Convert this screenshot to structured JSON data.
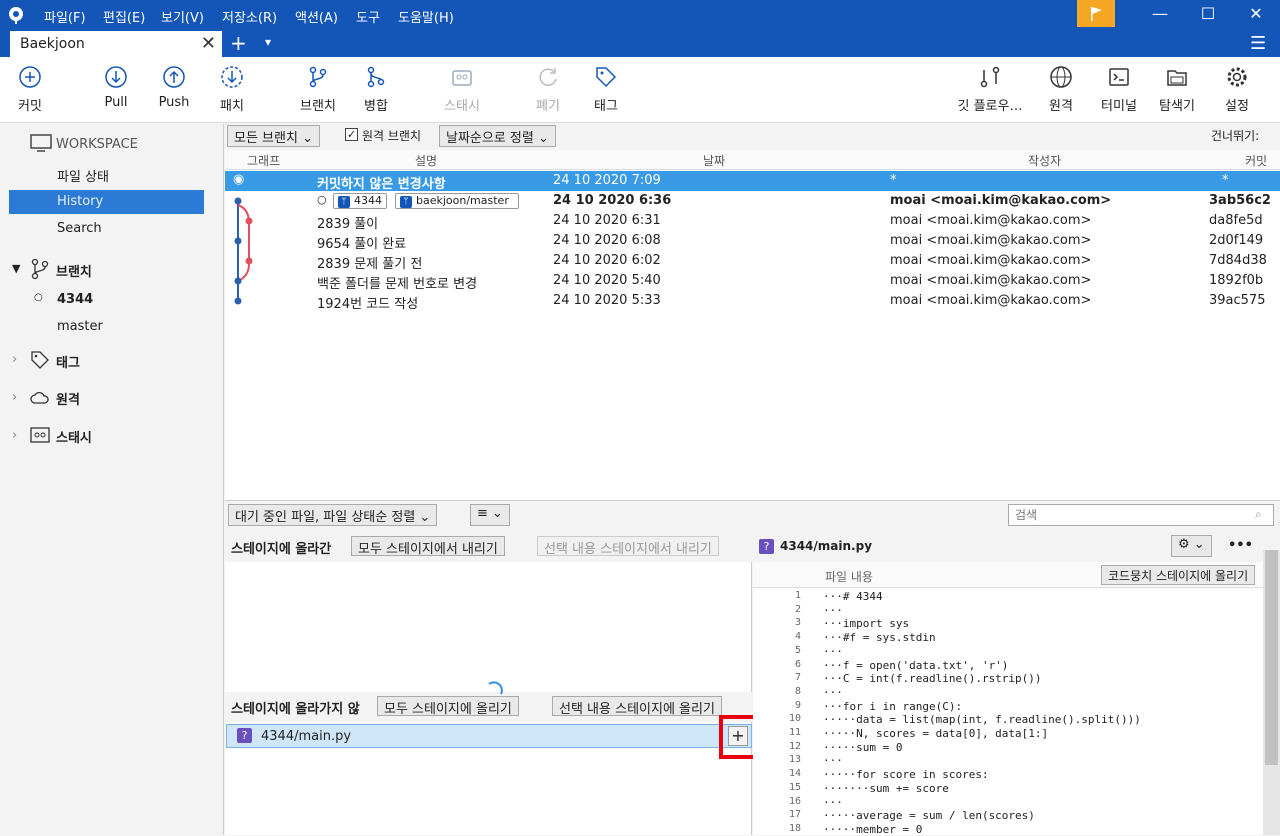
{
  "menubar": {
    "items": [
      "파일(F)",
      "편집(E)",
      "보기(V)",
      "저장소(R)",
      "액션(A)",
      "도구",
      "도움말(H)"
    ]
  },
  "tab": {
    "name": "Baekjoon",
    "close": "✕",
    "new": "+",
    "dropdown": "▾"
  },
  "toolbar": {
    "commit": "커밋",
    "pull": "Pull",
    "push": "Push",
    "patch": "패치",
    "branch": "브랜치",
    "merge": "병합",
    "stash": "스태시",
    "discard": "폐기",
    "tag": "태그",
    "gitflow": "깃 플로우…",
    "remote": "원격",
    "terminal": "터미널",
    "explorer": "탐색기",
    "settings": "설정"
  },
  "sidebar": {
    "workspace": "WORKSPACE",
    "file_status": "파일 상태",
    "history": "History",
    "search": "Search",
    "branches": "브랜치",
    "branch1": "4344",
    "branch2": "master",
    "tags": "태그",
    "remotes": "원격",
    "stashes": "스태시"
  },
  "history": {
    "all_branches": "모든 브랜치 ⌄",
    "remote_branch": "원격 브랜치",
    "sort": "날짜순으로 정렬 ⌄",
    "skip": "건너뛰기:",
    "columns": {
      "graph": "그래프",
      "desc": "설명",
      "date": "날짜",
      "author": "작성자",
      "commit": "커밋"
    },
    "rows": [
      {
        "desc": "커밋하지 않은 변경사항",
        "date": "24 10 2020 7:09",
        "author": "*",
        "commit": "*"
      },
      {
        "desc": "",
        "tag1": "4344",
        "tag2": "baekjoon/master",
        "date": "24 10 2020 6:36",
        "author": "moai <moai.kim@kakao.com>",
        "commit": "3ab56c2"
      },
      {
        "desc": "2839 풀이",
        "date": "24 10 2020 6:31",
        "author": "moai <moai.kim@kakao.com>",
        "commit": "da8fe5d"
      },
      {
        "desc": "9654 풀이 완료",
        "date": "24 10 2020 6:08",
        "author": "moai <moai.kim@kakao.com>",
        "commit": "2d0f149"
      },
      {
        "desc": "2839 문제 풀기 전",
        "date": "24 10 2020 6:02",
        "author": "moai <moai.kim@kakao.com>",
        "commit": "7d84d38"
      },
      {
        "desc": "백준 폴더를 문제 번호로 변경",
        "date": "24 10 2020 5:40",
        "author": "moai <moai.kim@kakao.com>",
        "commit": "1892f0b"
      },
      {
        "desc": "1924번 코드 작성",
        "date": "24 10 2020 5:33",
        "author": "moai <moai.kim@kakao.com>",
        "commit": "39ac575"
      }
    ]
  },
  "filter": {
    "pending": "대기 중인 파일, 파일 상태순 정렬 ⌄",
    "view": "≡ ⌄",
    "search_placeholder": "검색"
  },
  "staged": {
    "title": "스테이지에 올라간",
    "unstage_all": "모두 스테이지에서 내리기",
    "unstage_sel": "선택 내용 스테이지에서 내리기"
  },
  "unstaged": {
    "title": "스테이지에 올라가지 않",
    "stage_all": "모두 스테이지에 올리기",
    "stage_sel": "선택 내용 스테이지에 올리기",
    "file": "4344/main.py",
    "add": "+"
  },
  "diff": {
    "file": "4344/main.py",
    "gear": "⚙ ⌄",
    "more": "•••",
    "label": "파일 내용",
    "stage_hunk": "코드뭉치 스테이지에 올리기",
    "lines": [
      "···# 4344",
      "···",
      "···import sys",
      "···#f = sys.stdin",
      "···",
      "···f = open('data.txt', 'r')",
      "···C = int(f.readline().rstrip())",
      "···",
      "···for i in range(C):",
      "·····data = list(map(int, f.readline().split()))",
      "·····N, scores = data[0], data[1:]",
      "·····sum = 0",
      "···",
      "·····for score in scores:",
      "·······sum += score",
      "···",
      "·····average = sum / len(scores)",
      "·····member = 0"
    ]
  },
  "colors": {
    "accent": "#1456b8",
    "selection": "#399be6",
    "flag": "#f5a623",
    "highlight": "#e8000b"
  }
}
